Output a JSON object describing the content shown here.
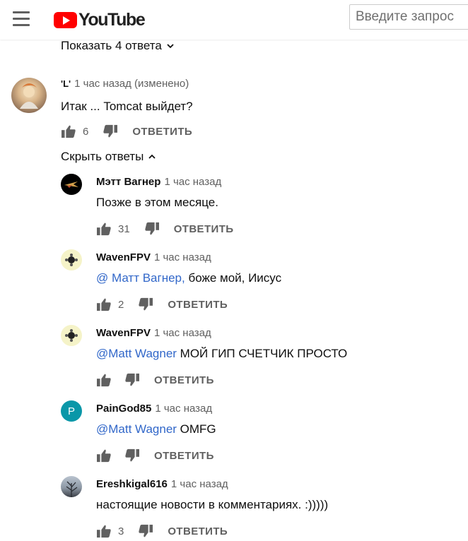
{
  "header": {
    "logo_text": "YouTube",
    "search_placeholder": "Введите запрос"
  },
  "show_replies": {
    "label": "Показать 4 ответа"
  },
  "main_comment": {
    "author": "'L'",
    "time": "1 час назад (изменено)",
    "text": "Итак ... Tomcat выйдет?",
    "likes": "6",
    "reply_label": "ОТВЕТИТЬ"
  },
  "hide_replies": {
    "label": "Скрыть ответы"
  },
  "replies": [
    {
      "author": "Мэтт Вагнер",
      "time": "1 час назад",
      "mention": "",
      "text": "Позже в этом месяце.",
      "likes": "31",
      "reply_label": "ОТВЕТИТЬ"
    },
    {
      "author": "WavenFPV",
      "time": "1 час назад",
      "mention": "@ Матт Вагнер,",
      "text": " боже мой, Иисус",
      "likes": "2",
      "reply_label": "ОТВЕТИТЬ"
    },
    {
      "author": "WavenFPV",
      "time": "1 час назад",
      "mention": "@Matt Wagner",
      "text": " МОЙ ГИП СЧЕТЧИК ПРОСТО",
      "likes": "",
      "reply_label": "ОТВЕТИТЬ"
    },
    {
      "author": "PainGod85",
      "time": "1 час назад",
      "mention": "@Matt Wagner",
      "text": " OMFG",
      "likes": "",
      "reply_label": "ОТВЕТИТЬ",
      "avatar_letter": "P"
    },
    {
      "author": "Ereshkigal616",
      "time": "1 час назад",
      "mention": "",
      "text": "настоящие новости в комментариях. :)))))",
      "likes": "3",
      "reply_label": "ОТВЕТИТЬ"
    }
  ],
  "colors": {
    "youtube_red": "#ff0000",
    "mention_blue": "#3167c9",
    "meta_gray": "#606060",
    "paingod_avatar": "#0a97a8"
  }
}
